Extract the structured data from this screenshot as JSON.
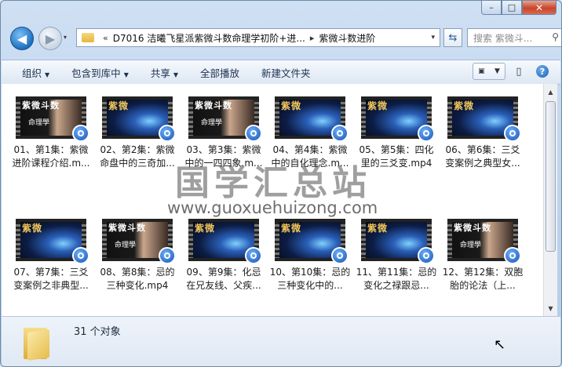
{
  "window": {
    "caption_minimize": "–",
    "caption_maximize": "□",
    "caption_close": "✕"
  },
  "address": {
    "history_glyph": "▾",
    "overflow": "«",
    "path_segments": [
      "D7016 洁曦飞星派紫微斗数命理学初阶+进...",
      "紫微斗数进阶"
    ],
    "separator": "▸",
    "dropdown": "▾",
    "refresh_icon": "refresh-icon",
    "search_placeholder": "搜索 紫微斗..."
  },
  "toolbar": {
    "organize": "组织",
    "include_in_library": "包含到库中",
    "share": "共享",
    "play_all": "全部播放",
    "new_folder": "新建文件夹"
  },
  "files": [
    {
      "label": "01、第1集：紫微进阶课程介绍.m...",
      "thumb_text": "紫微斗数",
      "thumb_sub": "命理學",
      "style": "a"
    },
    {
      "label": "02、第2集：紫微命盘中的三奇加...",
      "thumb_text": "紫微",
      "thumb_sub": "",
      "style": "b"
    },
    {
      "label": "03、第3集：紫微中的一四四象.m...",
      "thumb_text": "紫微斗数",
      "thumb_sub": "命理學",
      "style": "a"
    },
    {
      "label": "04、第4集：紫微中的自化理念.m...",
      "thumb_text": "紫微",
      "thumb_sub": "",
      "style": "b"
    },
    {
      "label": "05、第5集：四化里的三爻变.mp4",
      "thumb_text": "紫微",
      "thumb_sub": "",
      "style": "b"
    },
    {
      "label": "06、第6集：三爻变案例之典型女...",
      "thumb_text": "紫微",
      "thumb_sub": "",
      "style": "b"
    },
    {
      "label": "07、第7集：三爻变案例之非典型...",
      "thumb_text": "紫微",
      "thumb_sub": "",
      "style": "b"
    },
    {
      "label": "08、第8集：忌的三种变化.mp4",
      "thumb_text": "紫微斗数",
      "thumb_sub": "命理學",
      "style": "a"
    },
    {
      "label": "09、第9集：化忌在兄友线、父疾...",
      "thumb_text": "紫微",
      "thumb_sub": "",
      "style": "b"
    },
    {
      "label": "10、第10集：忌的三种变化中的...",
      "thumb_text": "紫微",
      "thumb_sub": "",
      "style": "b"
    },
    {
      "label": "11、第11集：忌的变化之禄跟忌...",
      "thumb_text": "紫微",
      "thumb_sub": "",
      "style": "b"
    },
    {
      "label": "12、第12集：双胞胎的论法（上...",
      "thumb_text": "紫微斗数",
      "thumb_sub": "命理學",
      "style": "a"
    }
  ],
  "status": {
    "count": "31 个对象"
  },
  "watermark": {
    "title": "国学汇总站",
    "url": "www.guoxuehuizong.com"
  }
}
